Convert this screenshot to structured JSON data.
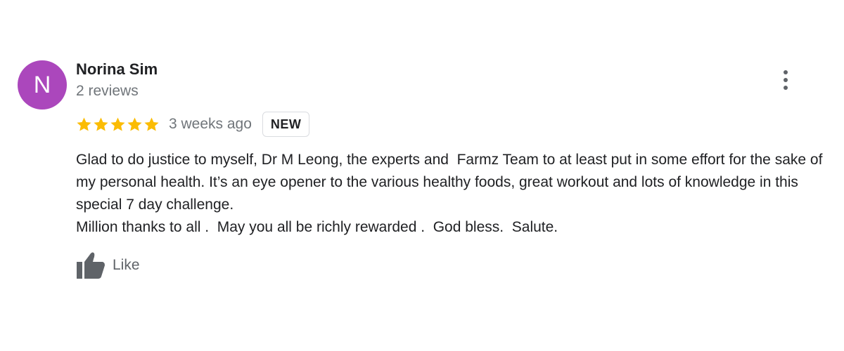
{
  "review": {
    "author": {
      "initial": "N",
      "name": "Norina Sim",
      "review_count": "2 reviews",
      "avatar_color": "#ab47bc"
    },
    "rating": {
      "stars": 5,
      "max": 5,
      "star_color": "#fbbc04"
    },
    "time_ago": "3 weeks ago",
    "badge": "NEW",
    "text": "Glad to do justice to myself, Dr M Leong, the experts and  Farmz Team to at least put in some effort for the sake of my personal health. It’s an eye opener to the various healthy foods, great workout and lots of knowledge in this special 7 day challenge.\nMillion thanks to all .  May you all be richly rewarded .  God bless.  Salute.",
    "actions": {
      "more_icon": "more-vertical-icon",
      "like_icon": "thumb-up-icon",
      "like_label": "Like"
    }
  }
}
